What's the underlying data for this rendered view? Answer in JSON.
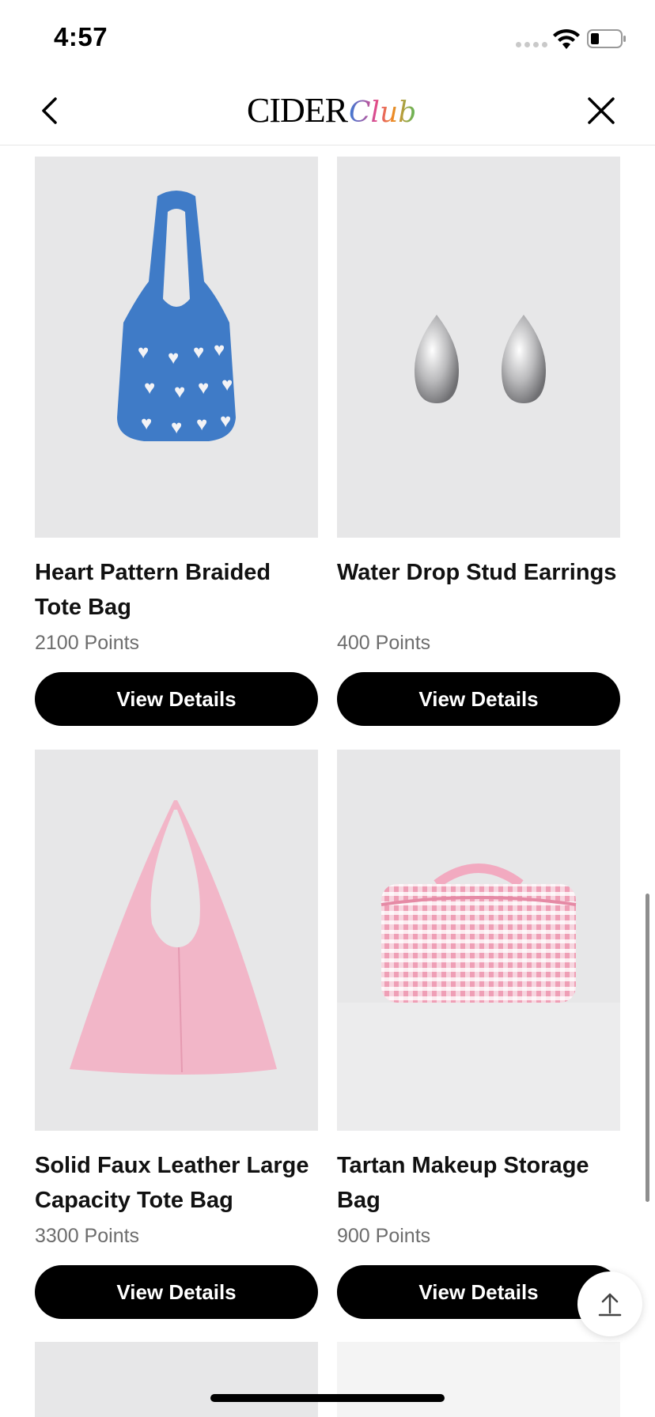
{
  "status_bar": {
    "time": "4:57"
  },
  "nav": {
    "logo_main": "CIDER",
    "logo_club": "Club",
    "back_icon": "chevron-left-icon",
    "close_icon": "close-icon"
  },
  "products": [
    {
      "title": "Heart Pattern Braided Tote Bag",
      "points": "2100 Points",
      "button": "View Details",
      "color": "#3f7bc7"
    },
    {
      "title": "Water Drop Stud Earrings",
      "points": "400 Points",
      "button": "View Details",
      "color": "#c7c7c9"
    },
    {
      "title": "Solid Faux Leather Large Capacity Tote Bag",
      "points": "3300 Points",
      "button": "View Details",
      "color": "#f2b6c8"
    },
    {
      "title": "Tartan Makeup Storage Bag",
      "points": "900 Points",
      "button": "View Details",
      "color": "#f4a8bd"
    }
  ],
  "scroll_top_icon": "arrow-up-to-top-icon",
  "colors": {
    "button_bg": "#000000",
    "image_bg": "#e7e7e8",
    "points_text": "#6d6d6d"
  }
}
